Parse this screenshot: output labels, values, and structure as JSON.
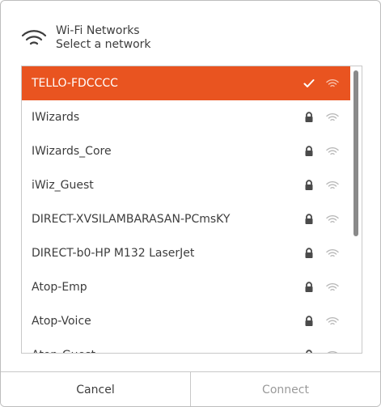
{
  "header": {
    "title": "Wi-Fi Networks",
    "subtitle": "Select a network",
    "icon": "wifi-icon"
  },
  "networks": [
    {
      "ssid": "TELLO-FDCCCC",
      "selected": true,
      "status_icon": "check-icon",
      "signal_icon": "wifi-signal-icon"
    },
    {
      "ssid": "IWizards",
      "selected": false,
      "status_icon": "lock-icon",
      "signal_icon": "wifi-signal-icon"
    },
    {
      "ssid": "IWizards_Core",
      "selected": false,
      "status_icon": "lock-icon",
      "signal_icon": "wifi-signal-icon"
    },
    {
      "ssid": "iWiz_Guest",
      "selected": false,
      "status_icon": "lock-icon",
      "signal_icon": "wifi-signal-icon"
    },
    {
      "ssid": "DIRECT-XVSILAMBARASAN-PCmsKY",
      "selected": false,
      "status_icon": "lock-icon",
      "signal_icon": "wifi-signal-icon"
    },
    {
      "ssid": "DIRECT-b0-HP M132 LaserJet",
      "selected": false,
      "status_icon": "lock-icon",
      "signal_icon": "wifi-signal-icon"
    },
    {
      "ssid": "Atop-Emp",
      "selected": false,
      "status_icon": "lock-icon",
      "signal_icon": "wifi-signal-icon"
    },
    {
      "ssid": "Atop-Voice",
      "selected": false,
      "status_icon": "lock-icon",
      "signal_icon": "wifi-signal-icon"
    },
    {
      "ssid": "Atop-Guest",
      "selected": false,
      "status_icon": "lock-icon",
      "signal_icon": "wifi-signal-icon"
    }
  ],
  "buttons": {
    "cancel": "Cancel",
    "connect": "Connect"
  },
  "colors": {
    "accent": "#e95420",
    "text": "#3d3d3d",
    "disabled_text": "#9a9a9a"
  }
}
